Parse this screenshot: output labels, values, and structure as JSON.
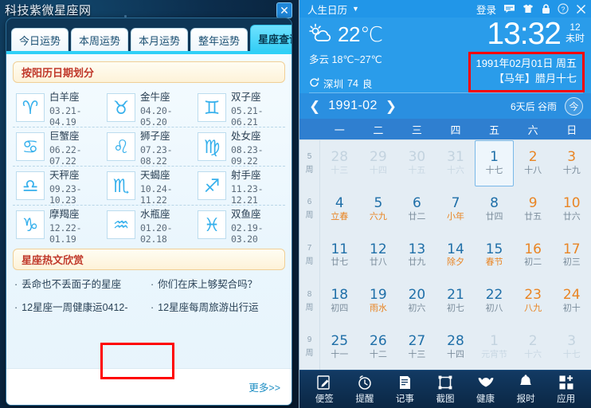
{
  "desktop": {
    "site_title": "科技紫微星座网"
  },
  "zodiac_window": {
    "close_label": "✕",
    "tabs": [
      {
        "label": "今日运势",
        "active": false
      },
      {
        "label": "本周运势",
        "active": false
      },
      {
        "label": "本月运势",
        "active": false
      },
      {
        "label": "整年运势",
        "active": false
      },
      {
        "label": "星座查询",
        "active": true
      }
    ],
    "section_head": "按阳历日期划分",
    "signs": [
      {
        "name": "白羊座",
        "dates": "03.21-04.19",
        "glyph": "♈"
      },
      {
        "name": "金牛座",
        "dates": "04.20-05.20",
        "glyph": "♉"
      },
      {
        "name": "双子座",
        "dates": "05.21-06.21",
        "glyph": "♊"
      },
      {
        "name": "巨蟹座",
        "dates": "06.22-07.22",
        "glyph": "♋"
      },
      {
        "name": "狮子座",
        "dates": "07.23-08.22",
        "glyph": "♌"
      },
      {
        "name": "处女座",
        "dates": "08.23-09.22",
        "glyph": "♍"
      },
      {
        "name": "天秤座",
        "dates": "09.23-10.23",
        "glyph": "♎"
      },
      {
        "name": "天蝎座",
        "dates": "10.24-11.22",
        "glyph": "♏"
      },
      {
        "name": "射手座",
        "dates": "11.23-12.21",
        "glyph": "♐"
      },
      {
        "name": "摩羯座",
        "dates": "12.22-01.19",
        "glyph": "♑"
      },
      {
        "name": "水瓶座",
        "dates": "01.20-02.18",
        "glyph": "♒"
      },
      {
        "name": "双鱼座",
        "dates": "02.19-03.20",
        "glyph": "♓"
      }
    ],
    "highlighted_sign": "水瓶座",
    "hot_head": "星座热文欣赏",
    "hot_articles": [
      "丢命也不丢面子的星座",
      "你们在床上够契合吗？",
      "12星座一周健康运0412-",
      "12星座每周旅游出行运"
    ],
    "more_label": "更多>>"
  },
  "calendar_app": {
    "app_title": "人生日历",
    "title_dropdown": "▼",
    "login_label": "登录",
    "titlebar_icons": [
      "message-icon",
      "skin-icon",
      "lock-icon",
      "help-icon",
      "close-icon"
    ],
    "weather": {
      "temp": "22℃",
      "condition": "多云",
      "range": "18℃~27℃",
      "city": "深圳",
      "aqi": "74",
      "aqi_level": "良"
    },
    "clock": {
      "time": "13:32",
      "hour_index": "12",
      "shichen": "未时"
    },
    "date_box": {
      "solar": "1991年02月01日 周五",
      "lunar": "【马年】腊月十七"
    },
    "nav": {
      "prev": "❮",
      "next": "❯",
      "month": "1991-02",
      "term_hint": "6天后 谷雨",
      "today_label": "今"
    },
    "weekdays": [
      "一",
      "二",
      "三",
      "四",
      "五",
      "六",
      "日"
    ],
    "week_suffix": "周",
    "weeks": [
      {
        "num": "5",
        "days": [
          {
            "d": "28",
            "l": "十三",
            "muted": true
          },
          {
            "d": "29",
            "l": "十四",
            "muted": true
          },
          {
            "d": "30",
            "l": "十五",
            "muted": true
          },
          {
            "d": "31",
            "l": "十六",
            "muted": true
          },
          {
            "d": "1",
            "l": "十七",
            "selected": true
          },
          {
            "d": "2",
            "l": "十八",
            "weekend": true
          },
          {
            "d": "3",
            "l": "十九",
            "weekend": true
          }
        ]
      },
      {
        "num": "6",
        "days": [
          {
            "d": "4",
            "l": "立春",
            "lunar_hl": true
          },
          {
            "d": "5",
            "l": "六九",
            "lunar_hl": true
          },
          {
            "d": "6",
            "l": "廿二"
          },
          {
            "d": "7",
            "l": "小年",
            "lunar_hl": true
          },
          {
            "d": "8",
            "l": "廿四"
          },
          {
            "d": "9",
            "l": "廿五",
            "weekend": true
          },
          {
            "d": "10",
            "l": "廿六",
            "weekend": true
          }
        ]
      },
      {
        "num": "7",
        "days": [
          {
            "d": "11",
            "l": "廿七"
          },
          {
            "d": "12",
            "l": "廿八"
          },
          {
            "d": "13",
            "l": "廿九"
          },
          {
            "d": "14",
            "l": "除夕",
            "lunar_hl": true
          },
          {
            "d": "15",
            "l": "春节",
            "lunar_hl": true
          },
          {
            "d": "16",
            "l": "初二",
            "weekend": true
          },
          {
            "d": "17",
            "l": "初三",
            "weekend": true
          }
        ]
      },
      {
        "num": "8",
        "days": [
          {
            "d": "18",
            "l": "初四"
          },
          {
            "d": "19",
            "l": "雨水",
            "lunar_hl": true
          },
          {
            "d": "20",
            "l": "初六"
          },
          {
            "d": "21",
            "l": "初七"
          },
          {
            "d": "22",
            "l": "初八"
          },
          {
            "d": "23",
            "l": "八九",
            "weekend": true,
            "lunar_hl": true
          },
          {
            "d": "24",
            "l": "初十",
            "weekend": true
          }
        ]
      },
      {
        "num": "9",
        "days": [
          {
            "d": "25",
            "l": "十一"
          },
          {
            "d": "26",
            "l": "十二"
          },
          {
            "d": "27",
            "l": "十三"
          },
          {
            "d": "28",
            "l": "十四"
          },
          {
            "d": "1",
            "l": "元宵节",
            "muted": true
          },
          {
            "d": "2",
            "l": "十六",
            "muted": true
          },
          {
            "d": "3",
            "l": "十七",
            "muted": true
          }
        ]
      }
    ],
    "toolbar": [
      {
        "label": "便签",
        "icon": "note-pencil-icon"
      },
      {
        "label": "提醒",
        "icon": "alarm-clock-icon"
      },
      {
        "label": "记事",
        "icon": "memo-icon"
      },
      {
        "label": "截图",
        "icon": "screenshot-icon"
      },
      {
        "label": "健康",
        "icon": "health-icon"
      },
      {
        "label": "报时",
        "icon": "bell-icon"
      },
      {
        "label": "应用",
        "icon": "apps-grid-icon"
      }
    ]
  },
  "colors": {
    "accent_blue": "#2a9cea",
    "tab_active": "#33cdf5",
    "highlight_red": "#ff0000",
    "weekend_orange": "#e98524",
    "day_blue": "#1f6fa8"
  }
}
